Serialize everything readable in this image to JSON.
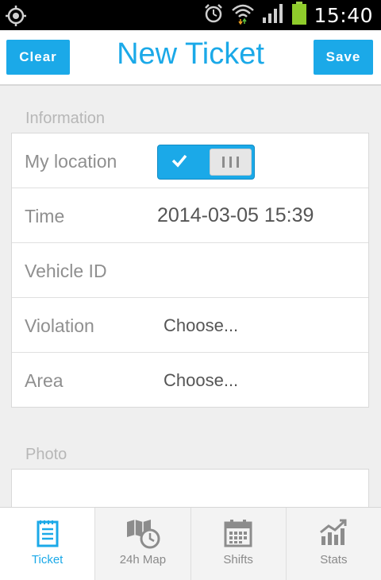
{
  "status_bar": {
    "time": "15:40"
  },
  "header": {
    "clear_label": "Clear",
    "title": "New Ticket",
    "save_label": "Save"
  },
  "information": {
    "section_label": "Information",
    "my_location_label": "My location",
    "my_location_on": true,
    "time_label": "Time",
    "time_value": "2014-03-05 15:39",
    "vehicle_id_label": "Vehicle ID",
    "vehicle_id_value": "",
    "violation_label": "Violation",
    "violation_value": "Choose...",
    "area_label": "Area",
    "area_value": "Choose..."
  },
  "photo": {
    "section_label": "Photo"
  },
  "tabs": [
    {
      "label": "Ticket",
      "icon": "ticket-icon",
      "active": true
    },
    {
      "label": "24h Map",
      "icon": "map-clock-icon",
      "active": false
    },
    {
      "label": "Shifts",
      "icon": "calendar-icon",
      "active": false
    },
    {
      "label": "Stats",
      "icon": "stats-chart-icon",
      "active": false
    }
  ],
  "colors": {
    "accent": "#1ba9e8",
    "label_gray": "#8f8f8f",
    "value_gray": "#555555"
  }
}
